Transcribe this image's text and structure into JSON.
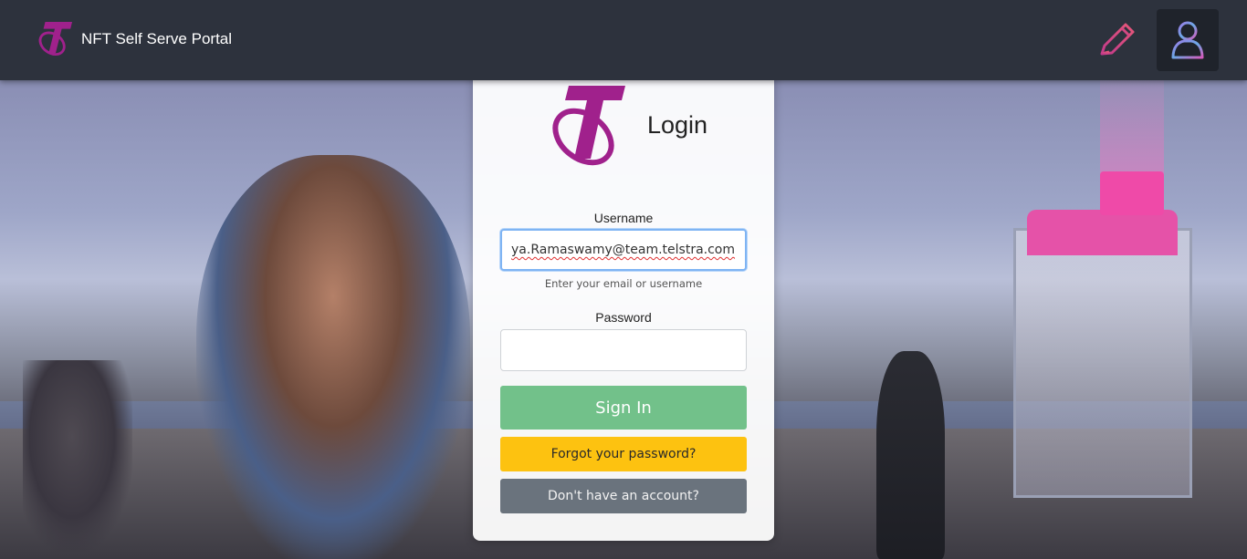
{
  "header": {
    "title": "NFT Self Serve Portal",
    "logo_icon": "telstra-logo-icon",
    "edit_icon": "pencil-icon",
    "user_icon": "user-icon"
  },
  "login": {
    "title": "Login",
    "username_label": "Username",
    "username_value": "ya.Ramaswamy@team.telstra.com",
    "username_hint": "Enter your email or username",
    "password_label": "Password",
    "password_value": "",
    "signin_label": "Sign In",
    "forgot_label": "Forgot your password?",
    "account_label": "Don't have an account?"
  },
  "colors": {
    "brand": "#a0218c",
    "header_bg": "#2d323d",
    "signin": "#72c18a",
    "forgot": "#fdc210",
    "account": "#6a737d"
  }
}
